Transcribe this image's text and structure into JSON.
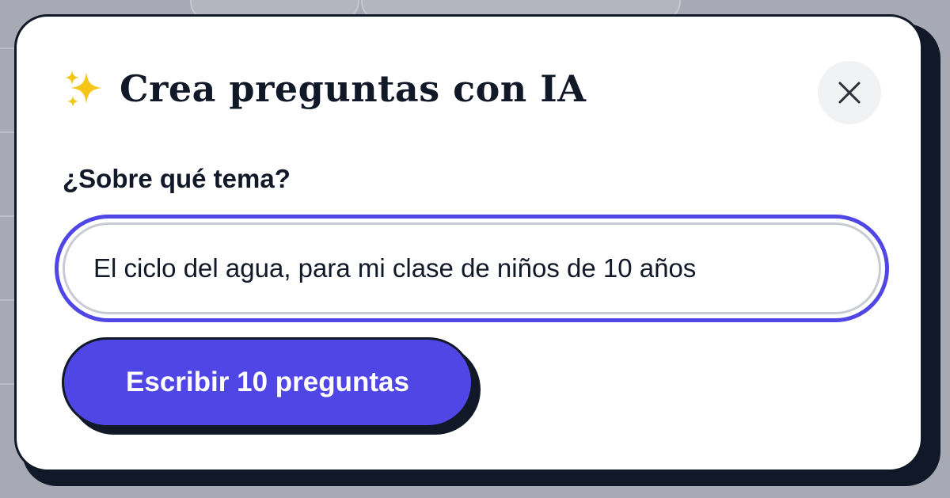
{
  "modal": {
    "title": "Crea preguntas con IA",
    "title_icon": "sparkles-icon",
    "close_icon": "close-icon"
  },
  "form": {
    "topic_label": "¿Sobre qué tema?",
    "topic_value": "El ciclo del agua, para mi clase de niños de 10 años",
    "submit_label": "Escribir 10 preguntas"
  },
  "colors": {
    "accent": "#4f46e5",
    "ink": "#111827",
    "overlay": "#a9abb6",
    "close_bg": "#f1f2f4",
    "sparkle": "#f5c518"
  }
}
